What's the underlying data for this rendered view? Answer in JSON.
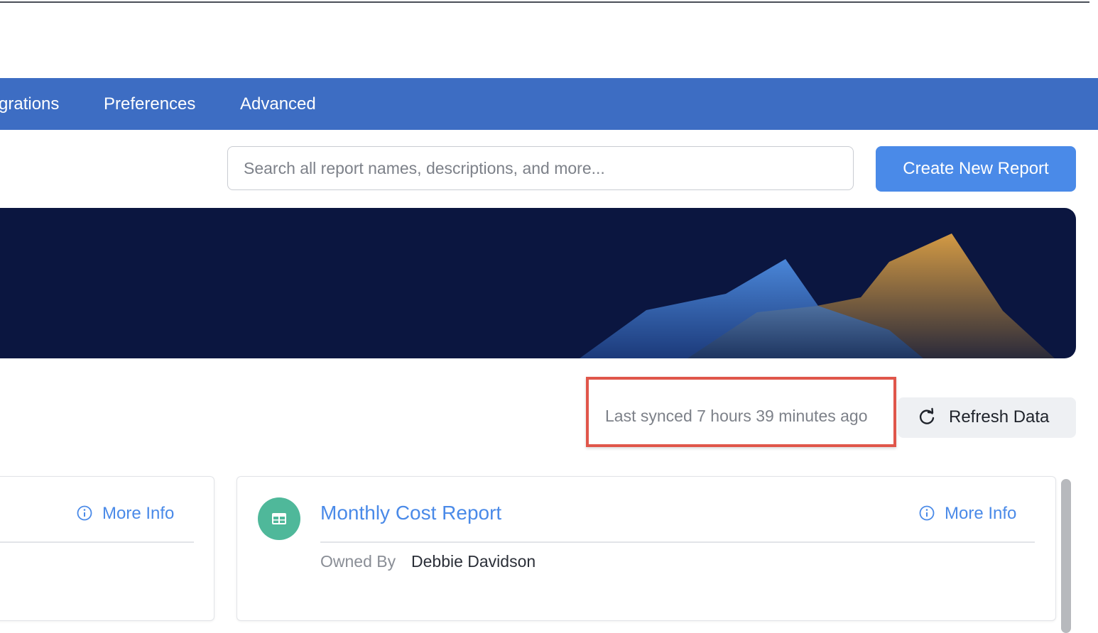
{
  "nav": {
    "tabs": [
      {
        "label": "grations"
      },
      {
        "label": "Preferences"
      },
      {
        "label": "Advanced"
      }
    ]
  },
  "search": {
    "placeholder": "Search all report names, descriptions, and more..."
  },
  "actions": {
    "create_label": "Create New Report",
    "refresh_label": "Refresh Data"
  },
  "sync": {
    "text": "Last synced 7 hours 39 minutes ago"
  },
  "cards": {
    "left": {
      "more_info_label": "More Info"
    },
    "main": {
      "title": "Monthly Cost Report",
      "more_info_label": "More Info",
      "owned_by_label": "Owned By",
      "owner": "Debbie Davidson"
    }
  },
  "colors": {
    "nav_bg": "#3d6dc3",
    "accent": "#4a8ae8",
    "banner_bg": "#0b1640",
    "highlight": "#e0564a",
    "report_icon_bg": "#4fb89a",
    "banner_orange": "#d39a44"
  },
  "icons": {
    "refresh": "refresh-icon",
    "info": "info-icon",
    "report": "table-icon"
  }
}
